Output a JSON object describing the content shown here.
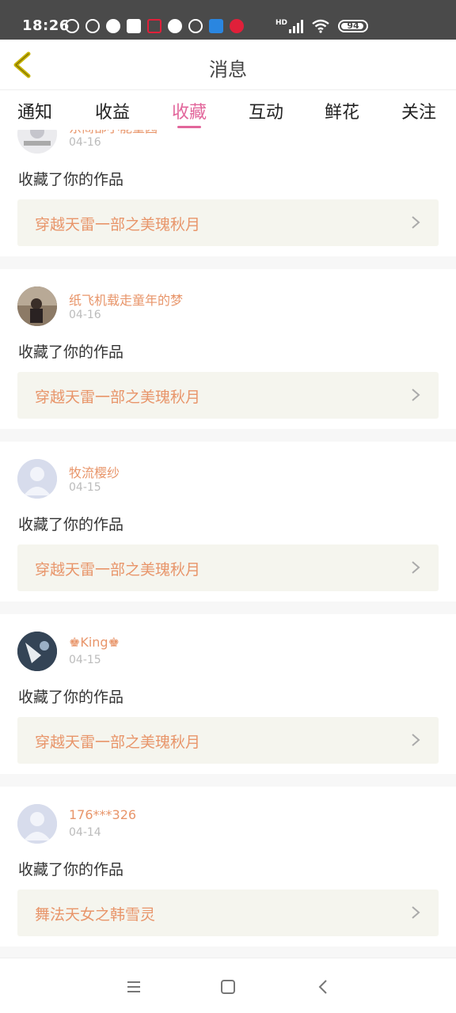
{
  "status_bar": {
    "time": "18:26",
    "signal_label": "HD",
    "battery": "94",
    "battery_level": 0.94,
    "icons": [
      "k-logo-icon",
      "bolt-shield-icon",
      "wechat-icon",
      "message-box-icon",
      "app-icon",
      "cloud-icon",
      "k-logo-icon",
      "blue-app-icon",
      "red-heart-app-icon",
      "signal-icon",
      "wifi-icon",
      "battery-icon"
    ]
  },
  "header": {
    "title": "消息",
    "back_icon": "chevron-left-icon",
    "accent_color": "#c8b400"
  },
  "tabs": [
    {
      "label": "通知",
      "active": false
    },
    {
      "label": "收益",
      "active": false
    },
    {
      "label": "收藏",
      "active": true
    },
    {
      "label": "互动",
      "active": false
    },
    {
      "label": "鲜花",
      "active": false
    },
    {
      "label": "关注",
      "active": false
    }
  ],
  "tab_active_color": "#e2669b",
  "items": [
    {
      "user": "东简部小能量园",
      "date": "04-16",
      "action": "收藏了你的作品",
      "work": "穿越天雷一部之美瑰秋月",
      "avatar": "photo-avatar"
    },
    {
      "user": "纸飞机载走童年的梦",
      "date": "04-16",
      "action": "收藏了你的作品",
      "work": "穿越天雷一部之美瑰秋月",
      "avatar": "photo-avatar"
    },
    {
      "user": "牧流樱纱",
      "date": "04-15",
      "action": "收藏了你的作品",
      "work": "穿越天雷一部之美瑰秋月",
      "avatar": "default-avatar"
    },
    {
      "user": "♚King♚",
      "date": "04-15",
      "action": "收藏了你的作品",
      "work": "穿越天雷一部之美瑰秋月",
      "avatar": "photo-avatar"
    },
    {
      "user": "176***326",
      "date": "04-14",
      "action": "收藏了你的作品",
      "work": "舞法天女之韩雪灵",
      "avatar": "default-avatar"
    }
  ],
  "colors": {
    "username": "#e8956a",
    "work_title": "#e8956a",
    "work_bg": "#f5f5ee"
  },
  "nav": {
    "menu_icon": "menu-icon",
    "home_icon": "home-square-icon",
    "back_icon": "back-triangle-icon"
  }
}
